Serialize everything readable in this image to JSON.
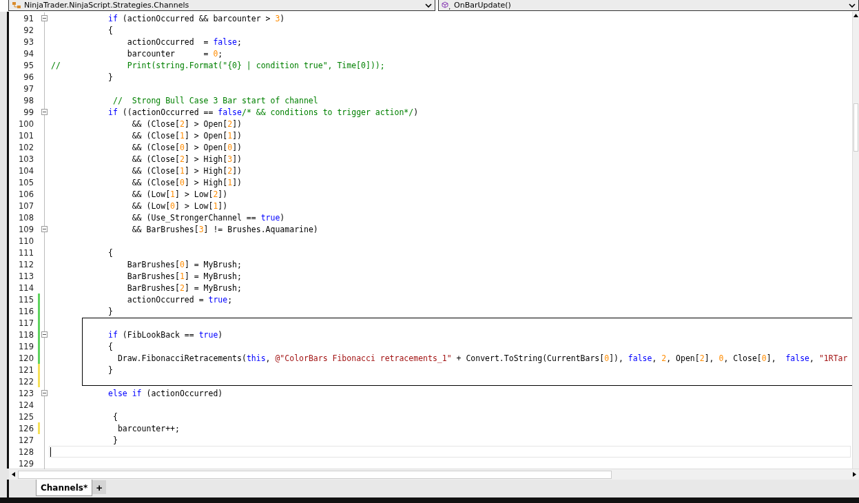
{
  "navigation": [
    {
      "kind": "class",
      "label": "NinjaTrader.NinjaScript.Strategies.Channels"
    },
    {
      "kind": "method",
      "label": "OnBarUpdate()"
    }
  ],
  "lines": [
    {
      "number": "91",
      "fold": true,
      "tokens": [
        {
          "kind": "keyword",
          "text": "            if"
        },
        {
          "kind": "code",
          "text": " (actionOccurred && barcounter > "
        },
        {
          "kind": "number",
          "text": "3"
        },
        {
          "kind": "code",
          "text": ")"
        }
      ]
    },
    {
      "number": "92",
      "tokens": [
        {
          "kind": "code",
          "text": "            {"
        }
      ]
    },
    {
      "number": "93",
      "tokens": [
        {
          "kind": "code",
          "text": "                actionOccurred  = "
        },
        {
          "kind": "keyword",
          "text": "false"
        },
        {
          "kind": "code",
          "text": ";"
        }
      ]
    },
    {
      "number": "94",
      "tokens": [
        {
          "kind": "code",
          "text": "                barcounter      = "
        },
        {
          "kind": "number",
          "text": "0"
        },
        {
          "kind": "code",
          "text": ";"
        }
      ]
    },
    {
      "number": "95",
      "tokens": [
        {
          "kind": "comment",
          "text": "//              Print(string.Format(\"{0} | condition true\", Time[0]));"
        }
      ]
    },
    {
      "number": "96",
      "tokens": [
        {
          "kind": "code",
          "text": "            }"
        }
      ]
    },
    {
      "number": "97"
    },
    {
      "number": "98",
      "tokens": [
        {
          "kind": "comment",
          "text": "             //  Strong Bull Case 3 Bar start of channel"
        }
      ]
    },
    {
      "number": "99",
      "fold": true,
      "tokens": [
        {
          "kind": "keyword",
          "text": "            if"
        },
        {
          "kind": "code",
          "text": " ((actionOccurred == "
        },
        {
          "kind": "keyword",
          "text": "false"
        },
        {
          "kind": "comment",
          "text": "/* && conditions to trigger action*/"
        },
        {
          "kind": "code",
          "text": ")"
        }
      ]
    },
    {
      "number": "100",
      "tokens": [
        {
          "kind": "code",
          "text": "                 && (Close["
        },
        {
          "kind": "number",
          "text": "2"
        },
        {
          "kind": "code",
          "text": "] > Open["
        },
        {
          "kind": "number",
          "text": "2"
        },
        {
          "kind": "code",
          "text": "])"
        }
      ]
    },
    {
      "number": "101",
      "tokens": [
        {
          "kind": "code",
          "text": "                 && (Close["
        },
        {
          "kind": "number",
          "text": "1"
        },
        {
          "kind": "code",
          "text": "] > Open["
        },
        {
          "kind": "number",
          "text": "1"
        },
        {
          "kind": "code",
          "text": "])"
        }
      ]
    },
    {
      "number": "102",
      "tokens": [
        {
          "kind": "code",
          "text": "                 && (Close["
        },
        {
          "kind": "number",
          "text": "0"
        },
        {
          "kind": "code",
          "text": "] > Open["
        },
        {
          "kind": "number",
          "text": "0"
        },
        {
          "kind": "code",
          "text": "])"
        }
      ]
    },
    {
      "number": "103",
      "tokens": [
        {
          "kind": "code",
          "text": "                 && (Close["
        },
        {
          "kind": "number",
          "text": "2"
        },
        {
          "kind": "code",
          "text": "] > High["
        },
        {
          "kind": "number",
          "text": "3"
        },
        {
          "kind": "code",
          "text": "])"
        }
      ]
    },
    {
      "number": "104",
      "tokens": [
        {
          "kind": "code",
          "text": "                 && (Close["
        },
        {
          "kind": "number",
          "text": "1"
        },
        {
          "kind": "code",
          "text": "] > High["
        },
        {
          "kind": "number",
          "text": "2"
        },
        {
          "kind": "code",
          "text": "])"
        }
      ]
    },
    {
      "number": "105",
      "tokens": [
        {
          "kind": "code",
          "text": "                 && (Close["
        },
        {
          "kind": "number",
          "text": "0"
        },
        {
          "kind": "code",
          "text": "] > High["
        },
        {
          "kind": "number",
          "text": "1"
        },
        {
          "kind": "code",
          "text": "])"
        }
      ]
    },
    {
      "number": "106",
      "tokens": [
        {
          "kind": "code",
          "text": "                 && (Low["
        },
        {
          "kind": "number",
          "text": "1"
        },
        {
          "kind": "code",
          "text": "] > Low["
        },
        {
          "kind": "number",
          "text": "2"
        },
        {
          "kind": "code",
          "text": "])"
        }
      ]
    },
    {
      "number": "107",
      "tokens": [
        {
          "kind": "code",
          "text": "                 && (Low["
        },
        {
          "kind": "number",
          "text": "0"
        },
        {
          "kind": "code",
          "text": "] > Low["
        },
        {
          "kind": "number",
          "text": "1"
        },
        {
          "kind": "code",
          "text": "])"
        }
      ]
    },
    {
      "number": "108",
      "tokens": [
        {
          "kind": "code",
          "text": "                 && (Use_StrongerChannel == "
        },
        {
          "kind": "keyword",
          "text": "true"
        },
        {
          "kind": "code",
          "text": ")"
        }
      ]
    },
    {
      "number": "109",
      "fold": true,
      "tokens": [
        {
          "kind": "code",
          "text": "                 && BarBrushes["
        },
        {
          "kind": "number",
          "text": "3"
        },
        {
          "kind": "code",
          "text": "] != Brushes.Aquamarine)"
        }
      ]
    },
    {
      "number": "110"
    },
    {
      "number": "111",
      "tokens": [
        {
          "kind": "code",
          "text": "            {"
        }
      ]
    },
    {
      "number": "112",
      "tokens": [
        {
          "kind": "code",
          "text": "                BarBrushes["
        },
        {
          "kind": "number",
          "text": "0"
        },
        {
          "kind": "code",
          "text": "] = MyBrush;"
        }
      ]
    },
    {
      "number": "113",
      "tokens": [
        {
          "kind": "code",
          "text": "                BarBrushes["
        },
        {
          "kind": "number",
          "text": "1"
        },
        {
          "kind": "code",
          "text": "] = MyBrush;"
        }
      ]
    },
    {
      "number": "114",
      "tokens": [
        {
          "kind": "code",
          "text": "                BarBrushes["
        },
        {
          "kind": "number",
          "text": "2"
        },
        {
          "kind": "code",
          "text": "] = MyBrush;"
        }
      ]
    },
    {
      "number": "115",
      "color": "#5fd35f",
      "tokens": [
        {
          "kind": "code",
          "text": "                actionOccurred = "
        },
        {
          "kind": "keyword",
          "text": "true"
        },
        {
          "kind": "code",
          "text": ";"
        }
      ]
    },
    {
      "number": "116",
      "color": "#5fd35f",
      "tokens": [
        {
          "kind": "code",
          "text": "            }"
        }
      ]
    },
    {
      "number": "117",
      "color": "#5fd35f",
      "framed": true
    },
    {
      "number": "118",
      "color": "#5fd35f",
      "framed": true,
      "fold": true,
      "tokens": [
        {
          "kind": "keyword",
          "text": "            if"
        },
        {
          "kind": "code",
          "text": " (FibLookBack == "
        },
        {
          "kind": "keyword",
          "text": "true"
        },
        {
          "kind": "code",
          "text": ")"
        }
      ]
    },
    {
      "number": "119",
      "color": "#5fd35f",
      "framed": true,
      "tokens": [
        {
          "kind": "code",
          "text": "            {"
        }
      ]
    },
    {
      "number": "120",
      "color": "#5fd35f",
      "framed": true,
      "tokens": [
        {
          "kind": "code",
          "text": "              Draw.FibonacciRetracements("
        },
        {
          "kind": "keyword",
          "text": "this"
        },
        {
          "kind": "code",
          "text": ", "
        },
        {
          "kind": "string",
          "text": "@\"ColorBars Fibonacci retracements_1\""
        },
        {
          "kind": "code",
          "text": " + Convert.ToString(CurrentBars["
        },
        {
          "kind": "number",
          "text": "0"
        },
        {
          "kind": "code",
          "text": "]), "
        },
        {
          "kind": "keyword",
          "text": "false"
        },
        {
          "kind": "code",
          "text": ", "
        },
        {
          "kind": "number",
          "text": "2"
        },
        {
          "kind": "code",
          "text": ", Open["
        },
        {
          "kind": "number",
          "text": "2"
        },
        {
          "kind": "code",
          "text": "], "
        },
        {
          "kind": "number",
          "text": "0"
        },
        {
          "kind": "code",
          "text": ", Close["
        },
        {
          "kind": "number",
          "text": "0"
        },
        {
          "kind": "code",
          "text": "],  "
        },
        {
          "kind": "keyword",
          "text": "false"
        },
        {
          "kind": "code",
          "text": ", "
        },
        {
          "kind": "string",
          "text": "\"1RTar"
        }
      ]
    },
    {
      "number": "121",
      "color": "#f5e15a",
      "framed": true,
      "tokens": [
        {
          "kind": "code",
          "text": "            }"
        }
      ]
    },
    {
      "number": "122",
      "color": "#f5e15a",
      "framed": true
    },
    {
      "number": "123",
      "fold": true,
      "tokens": [
        {
          "kind": "keyword",
          "text": "            else if"
        },
        {
          "kind": "code",
          "text": " (actionOccurred)"
        }
      ]
    },
    {
      "number": "124"
    },
    {
      "number": "125",
      "tokens": [
        {
          "kind": "code",
          "text": "             {"
        }
      ]
    },
    {
      "number": "126",
      "color": "#f5e15a",
      "tokens": [
        {
          "kind": "code",
          "text": "              barcounter++;"
        }
      ]
    },
    {
      "number": "127",
      "tokens": [
        {
          "kind": "code",
          "text": "             }"
        }
      ]
    },
    {
      "number": "128",
      "current": true
    },
    {
      "number": "129"
    }
  ],
  "tabs": [
    {
      "label": "Channels*",
      "selected": true
    }
  ],
  "new_tab_button": "+"
}
